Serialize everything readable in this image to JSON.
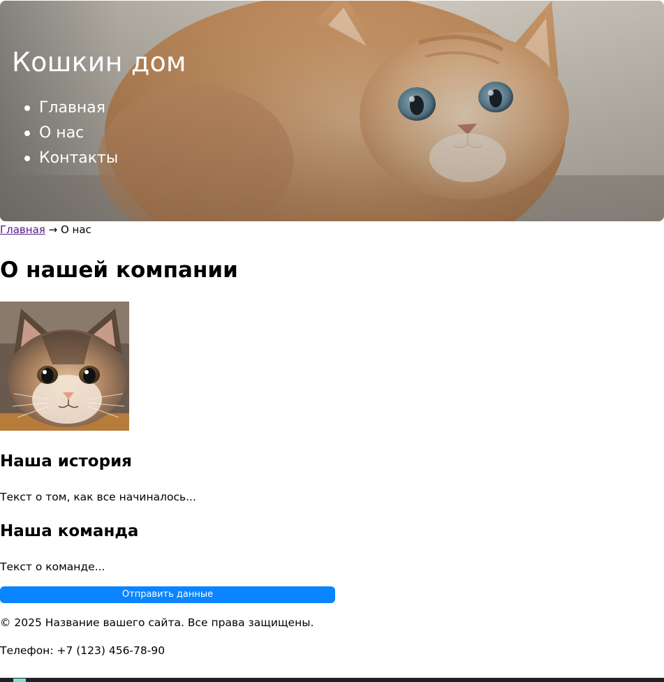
{
  "header": {
    "site_title": "Кошкин дом",
    "nav": [
      {
        "label": "Главная"
      },
      {
        "label": "О нас"
      },
      {
        "label": "Контакты"
      }
    ]
  },
  "breadcrumb": {
    "home_link": "Главная",
    "separator": "→",
    "current": "О нас"
  },
  "main": {
    "title": "О нашей компании",
    "sections": [
      {
        "heading": "Наша история",
        "text": "Текст о том, как все начиналось..."
      },
      {
        "heading": "Наша команда",
        "text": "Текст о команде..."
      }
    ],
    "submit_label": "Отправить данные"
  },
  "footer": {
    "copyright": "© 2025 Название вашего сайта. Все права защищены.",
    "phone": "Телефон: +7 (123) 456-78-90"
  },
  "colors": {
    "link_visited": "#551a8b",
    "button": "#0a84ff",
    "header_text": "#ffffff"
  },
  "icons": [
    "hero-kitten-image",
    "cat-photo",
    "arrow-right-icon"
  ]
}
